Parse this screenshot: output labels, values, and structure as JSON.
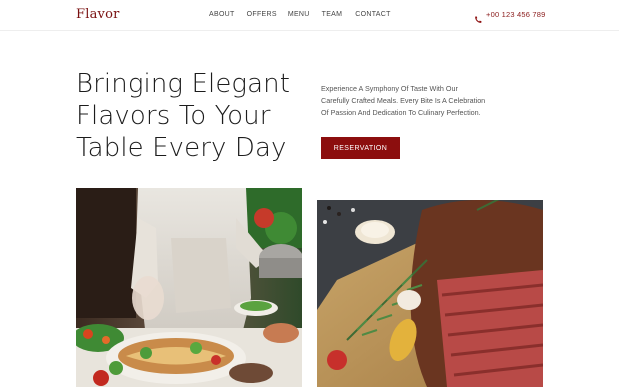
{
  "brand": {
    "logo_text": "Flavor",
    "accent_color": "#8c0e0e"
  },
  "nav": {
    "items": [
      {
        "label": "ABOUT"
      },
      {
        "label": "OFFERS"
      },
      {
        "label": "MENU"
      },
      {
        "label": "TEAM"
      },
      {
        "label": "CONTACT"
      }
    ]
  },
  "contact": {
    "phone": "+00 123 456 789",
    "icon": "phone-icon"
  },
  "hero": {
    "title_lines": [
      "Bringing Elegant",
      "Flavors To Your",
      "Table Every Day"
    ],
    "description_lines": [
      "Experience A Symphony Of Taste With Our",
      "Carefully Crafted Meals. Every Bite Is A Celebration",
      "Of Passion And Dedication To Culinary Perfection."
    ],
    "cta_label": "RESERVATION"
  },
  "images": {
    "left": "chef plating salad",
    "right": "sliced steak with rosemary"
  }
}
